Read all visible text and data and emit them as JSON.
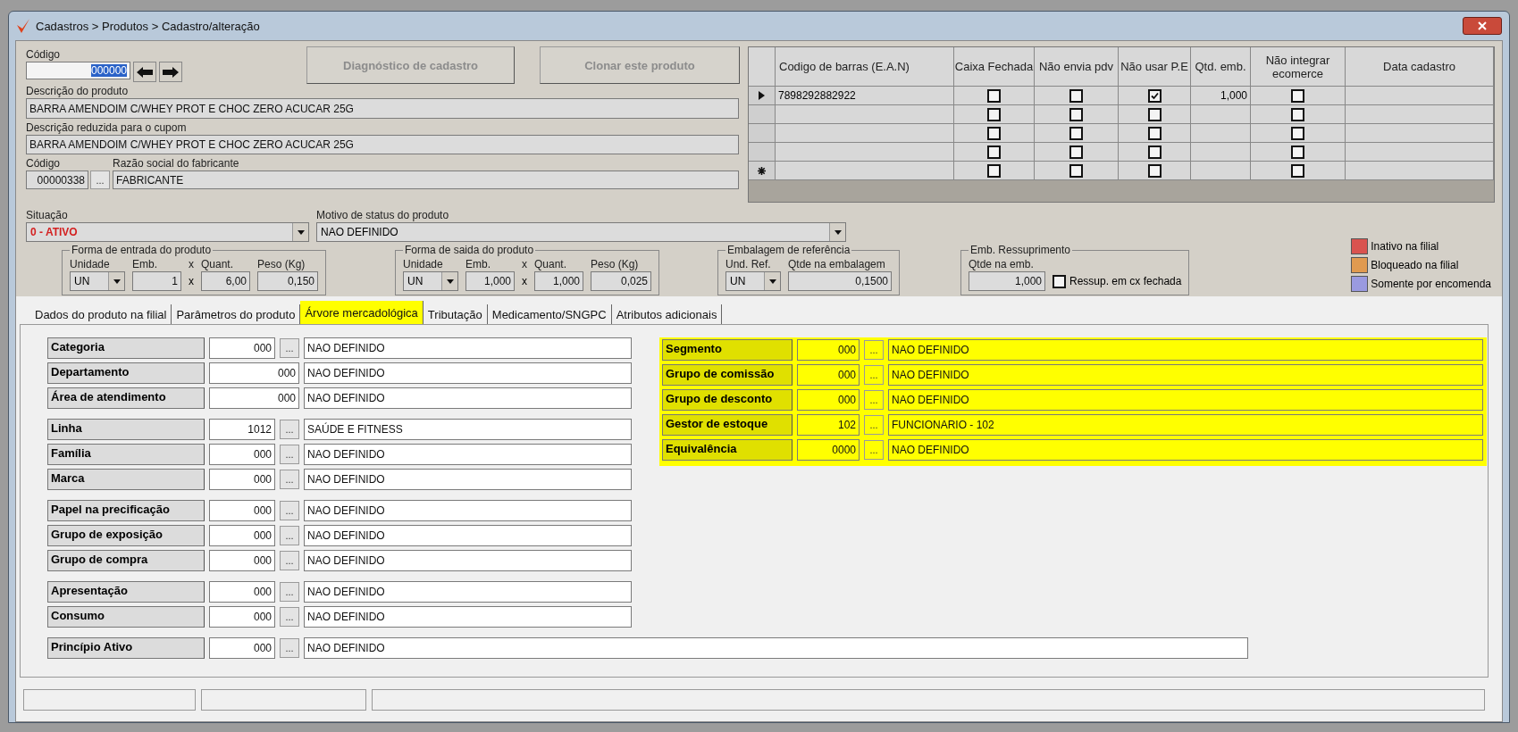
{
  "window": {
    "title": "Cadastros > Produtos > Cadastro/alteração"
  },
  "header": {
    "code": {
      "label": "Código",
      "value": "000000",
      "text_selected": true
    },
    "buttons": [
      {
        "label": "Diagnóstico de cadastro",
        "disabled": true
      },
      {
        "label": "Clonar este produto",
        "disabled": true
      }
    ],
    "description": {
      "label": "Descrição  do produto",
      "value": "BARRA AMENDOIM C/WHEY PROT E CHOC ZERO ACUCAR 25G"
    },
    "short_description": {
      "label": "Descrição reduzida para o cupom",
      "value": "BARRA AMENDOIM C/WHEY PROT E CHOC ZERO ACUCAR 25G"
    },
    "manufacturer": {
      "code_label": "Código",
      "code": "00000338",
      "lookup": "...",
      "name_label": "Razão social do fabricante",
      "name": "FABRICANTE"
    },
    "status": {
      "label": "Situação",
      "value": "0 - ATIVO"
    },
    "status_reason": {
      "label": "Motivo de status do produto",
      "value": "NAO DEFINIDO"
    }
  },
  "barcodes": {
    "columns": [
      "Codigo de barras (E.A.N)",
      "Caixa Fechada",
      "Não envia pdv",
      "Não usar P.E",
      "Qtd. emb.",
      "Não integrar ecomerce",
      "Data cadastro"
    ],
    "rows": [
      {
        "current": true,
        "new_record": false,
        "cells": [
          {
            "kind": "text",
            "text": "7898292882922"
          },
          {
            "kind": "check",
            "checked": false
          },
          {
            "kind": "check",
            "checked": false
          },
          {
            "kind": "check",
            "checked": true
          },
          {
            "kind": "number",
            "text": "1,000"
          },
          {
            "kind": "check",
            "checked": false
          },
          {
            "kind": "blank"
          }
        ]
      },
      {
        "current": false,
        "new_record": false,
        "cells": [
          {
            "kind": "blank"
          },
          {
            "kind": "check",
            "checked": false
          },
          {
            "kind": "check",
            "checked": false
          },
          {
            "kind": "check",
            "checked": false
          },
          {
            "kind": "blank"
          },
          {
            "kind": "check",
            "checked": false
          },
          {
            "kind": "blank"
          }
        ]
      },
      {
        "current": false,
        "new_record": false,
        "cells": [
          {
            "kind": "blank"
          },
          {
            "kind": "check",
            "checked": false
          },
          {
            "kind": "check",
            "checked": false
          },
          {
            "kind": "check",
            "checked": false
          },
          {
            "kind": "blank"
          },
          {
            "kind": "check",
            "checked": false
          },
          {
            "kind": "blank"
          }
        ]
      },
      {
        "current": false,
        "new_record": false,
        "cells": [
          {
            "kind": "blank"
          },
          {
            "kind": "check",
            "checked": false
          },
          {
            "kind": "check",
            "checked": false
          },
          {
            "kind": "check",
            "checked": false
          },
          {
            "kind": "blank"
          },
          {
            "kind": "check",
            "checked": false
          },
          {
            "kind": "blank"
          }
        ]
      },
      {
        "current": false,
        "new_record": true,
        "cells": [
          {
            "kind": "blank"
          },
          {
            "kind": "check",
            "checked": false
          },
          {
            "kind": "check",
            "checked": false
          },
          {
            "kind": "check",
            "checked": false
          },
          {
            "kind": "blank"
          },
          {
            "kind": "check",
            "checked": false
          },
          {
            "kind": "blank"
          }
        ]
      }
    ]
  },
  "unit_groups": [
    {
      "title": "Forma de entrada do produto",
      "fields": [
        {
          "kind": "combo",
          "label": "Unidade",
          "value": "UN"
        },
        {
          "kind": "number",
          "label": "Emb.",
          "value": "1"
        },
        {
          "kind": "operator",
          "label": "x",
          "value": "x"
        },
        {
          "kind": "number",
          "label": "Quant.",
          "value": "6,00"
        },
        {
          "kind": "number",
          "label": "Peso (Kg)",
          "value": "0,150"
        }
      ]
    },
    {
      "title": "Forma de saida do produto",
      "fields": [
        {
          "kind": "combo",
          "label": "Unidade",
          "value": "UN"
        },
        {
          "kind": "number",
          "label": "Emb.",
          "value": "1,000"
        },
        {
          "kind": "operator",
          "label": "x",
          "value": "x"
        },
        {
          "kind": "number",
          "label": "Quant.",
          "value": "1,000"
        },
        {
          "kind": "number",
          "label": "Peso (Kg)",
          "value": "0,025"
        }
      ]
    },
    {
      "title": "Embalagem de referência",
      "fields": [
        {
          "kind": "combo",
          "label": "Und. Ref.",
          "value": "UN"
        },
        {
          "kind": "number",
          "label": "Qtde na embalagem",
          "value": "0,1500"
        }
      ]
    },
    {
      "title": "Emb. Ressuprimento",
      "fields": [
        {
          "kind": "number",
          "label": "Qtde na emb.",
          "value": "1,000"
        },
        {
          "kind": "check",
          "label": "Ressup. em cx fechada",
          "checked": false
        }
      ]
    }
  ],
  "legend": [
    {
      "label": "Inativo na filial",
      "color": "#d9534f"
    },
    {
      "label": "Bloqueado na filial",
      "color": "#e09a50"
    },
    {
      "label": "Somente por encomenda",
      "color": "#9a9ae0"
    }
  ],
  "tabs": [
    {
      "label": "Dados do produto na filial",
      "selected": false
    },
    {
      "label": "Parâmetros do produto",
      "selected": false
    },
    {
      "label": "Árvore mercadológica",
      "selected": true
    },
    {
      "label": "Tributação",
      "selected": false
    },
    {
      "label": "Medicamento/SNGPC",
      "selected": false
    },
    {
      "label": "Atributos adicionais",
      "selected": false
    }
  ],
  "tree": {
    "left_groups": [
      [
        {
          "label": "Categoria",
          "code": "000",
          "lookup": "...",
          "value": "NAO DEFINIDO"
        },
        {
          "label": "Departamento",
          "code": "000",
          "value": "NAO DEFINIDO"
        },
        {
          "label": "Área de atendimento",
          "code": "000",
          "value": "NAO DEFINIDO"
        }
      ],
      [
        {
          "label": "Linha",
          "code": "1012",
          "lookup": "...",
          "value": "SAÚDE E FITNESS"
        },
        {
          "label": "Família",
          "code": "000",
          "lookup": "...",
          "value": "NAO DEFINIDO"
        },
        {
          "label": "Marca",
          "code": "000",
          "lookup": "...",
          "value": "NAO DEFINIDO"
        }
      ],
      [
        {
          "label": "Papel na precificação",
          "code": "000",
          "lookup": "...",
          "value": "NAO DEFINIDO"
        },
        {
          "label": "Grupo de exposição",
          "code": "000",
          "lookup": "...",
          "value": "NAO DEFINIDO"
        },
        {
          "label": "Grupo de compra",
          "code": "000",
          "lookup": "...",
          "value": "NAO DEFINIDO"
        }
      ],
      [
        {
          "label": "Apresentação",
          "code": "000",
          "lookup": "...",
          "value": "NAO DEFINIDO"
        },
        {
          "label": "Consumo",
          "code": "000",
          "lookup": "...",
          "value": "NAO DEFINIDO"
        }
      ]
    ],
    "right": {
      "highlighted": true,
      "rows": [
        {
          "label": "Segmento",
          "code": "000",
          "lookup": "...",
          "value": "NAO DEFINIDO"
        },
        {
          "label": "Grupo de comissão",
          "code": "000",
          "lookup": "...",
          "value": "NAO DEFINIDO"
        },
        {
          "label": "Grupo de desconto",
          "code": "000",
          "lookup": "...",
          "value": "NAO DEFINIDO"
        },
        {
          "label": "Gestor de estoque",
          "code": "102",
          "lookup": "...",
          "value": "FUNCIONARIO - 102"
        },
        {
          "label": "Equivalência",
          "code": "0000",
          "lookup": "...",
          "value": "NAO DEFINIDO"
        }
      ]
    },
    "footer_row": {
      "label": "Princípio Ativo",
      "code": "000",
      "lookup": "...",
      "value": "NAO DEFINIDO"
    }
  }
}
